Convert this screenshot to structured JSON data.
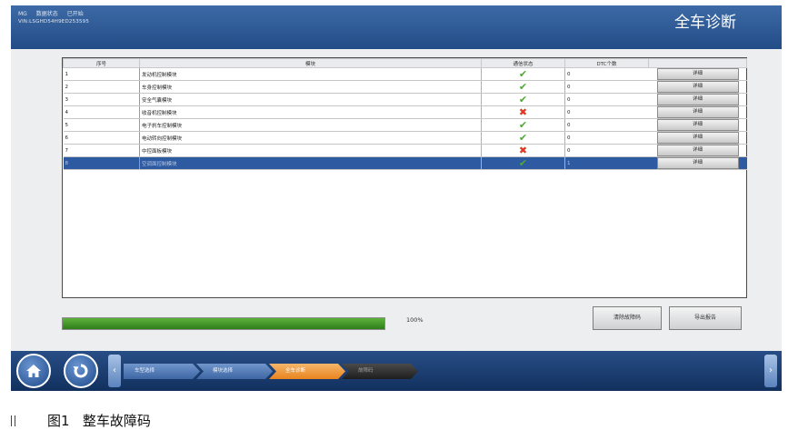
{
  "header": {
    "line1": [
      "MG",
      "数据状态",
      "已开始"
    ],
    "vin": "VIN:LSGHD54H9ED253595",
    "title": "全车诊断"
  },
  "table": {
    "columns": [
      "序号",
      "模块",
      "通信状态",
      "DTC个数",
      ""
    ],
    "rows": [
      {
        "no": "1",
        "module": "发动机控制模块",
        "status": "ok",
        "dtc": "0",
        "action": "详细",
        "selected": false
      },
      {
        "no": "2",
        "module": "车身控制模块",
        "status": "ok",
        "dtc": "0",
        "action": "详细",
        "selected": false
      },
      {
        "no": "3",
        "module": "安全气囊模块",
        "status": "ok",
        "dtc": "0",
        "action": "详细",
        "selected": false
      },
      {
        "no": "4",
        "module": "收音机控制模块",
        "status": "error",
        "dtc": "0",
        "action": "详细",
        "selected": false
      },
      {
        "no": "5",
        "module": "电子刹车控制模块",
        "status": "ok",
        "dtc": "0",
        "action": "详细",
        "selected": false
      },
      {
        "no": "6",
        "module": "电动转向控制模块",
        "status": "ok",
        "dtc": "0",
        "action": "详细",
        "selected": false
      },
      {
        "no": "7",
        "module": "中控面板模块",
        "status": "error",
        "dtc": "0",
        "action": "详细",
        "selected": false
      },
      {
        "no": "8",
        "module": "空调面控制模块",
        "status": "ok",
        "dtc": "1",
        "action": "详细",
        "selected": true
      }
    ]
  },
  "progress": {
    "value": 1.0,
    "label": "100%"
  },
  "buttons": {
    "clear": "清除故障码",
    "export": "导出报告"
  },
  "breadcrumbs": [
    {
      "label": "车型选择",
      "state": "done"
    },
    {
      "label": "模块选择",
      "state": "done"
    },
    {
      "label": "全车诊断",
      "state": "active"
    },
    {
      "label": "故障码",
      "state": "future"
    }
  ],
  "icons": {
    "home": "home-icon",
    "back": "refresh-back-icon",
    "left": "chevron-left-icon",
    "right": "chevron-right-icon"
  },
  "colors": {
    "header": "#2b5592",
    "selected_row": "#2e5aa1",
    "progress": "#3f9128",
    "active_crumb": "#ee9334"
  },
  "caption": {
    "label": "图1",
    "text": "整车故障码"
  }
}
